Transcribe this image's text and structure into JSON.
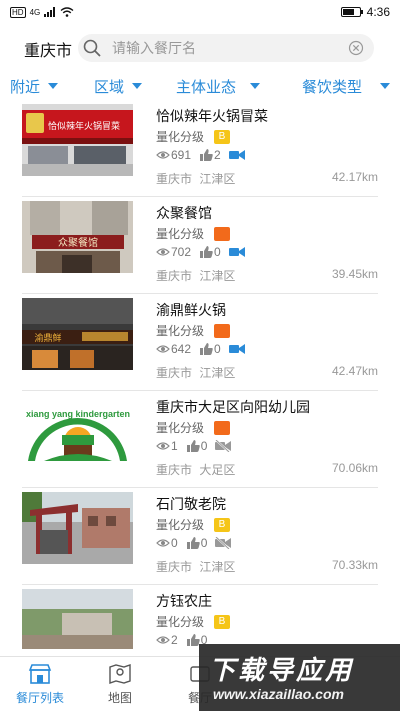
{
  "status_bar": {
    "network": "4G",
    "hd": "HD",
    "time": "4:36",
    "battery_level": 0.7
  },
  "search": {
    "city": "重庆市",
    "placeholder": "请输入餐厅名"
  },
  "filters": [
    {
      "label": "附近"
    },
    {
      "label": "区域"
    },
    {
      "label": "主体业态"
    },
    {
      "label": "餐饮类型"
    }
  ],
  "restaurants": [
    {
      "name": "恰似辣年火锅冒菜",
      "grade_label": "量化分级",
      "grade": "B",
      "grade_color": "#f5c518",
      "views": "691",
      "likes": "2",
      "video": true,
      "city": "重庆市",
      "district": "江津区",
      "distance": "42.17km",
      "sign_text": "恰似辣年火锅冒菜"
    },
    {
      "name": "众聚餐馆",
      "grade_label": "量化分级",
      "grade": "",
      "grade_color": "#f26a1b",
      "views": "702",
      "likes": "0",
      "video": true,
      "city": "重庆市",
      "district": "江津区",
      "distance": "39.45km",
      "sign_text": "众聚餐馆"
    },
    {
      "name": "渝鼎鲜火锅",
      "grade_label": "量化分级",
      "grade": "",
      "grade_color": "#f26a1b",
      "views": "642",
      "likes": "0",
      "video": true,
      "city": "重庆市",
      "district": "江津区",
      "distance": "42.47km",
      "sign_text": "渝鼎鲜"
    },
    {
      "name": "重庆市大足区向阳幼儿园",
      "grade_label": "量化分级",
      "grade": "",
      "grade_color": "#f26a1b",
      "views": "1",
      "likes": "0",
      "video": false,
      "city": "重庆市",
      "district": "大足区",
      "distance": "70.06km",
      "sign_text": "xiang yang kindergarten"
    },
    {
      "name": "石门敬老院",
      "grade_label": "量化分级",
      "grade": "B",
      "grade_color": "#f5c518",
      "views": "0",
      "likes": "0",
      "video": false,
      "city": "重庆市",
      "district": "江津区",
      "distance": "70.33km",
      "sign_text": ""
    },
    {
      "name": "方钰农庄",
      "grade_label": "量化分级",
      "grade": "B",
      "grade_color": "#f5c518",
      "views": "2",
      "likes": "0",
      "video": false,
      "city": "",
      "district": "",
      "distance": "",
      "sign_text": ""
    }
  ],
  "tabs": [
    {
      "label": "餐厅列表",
      "active": true
    },
    {
      "label": "地图",
      "active": false
    },
    {
      "label": "餐厅",
      "active": false
    }
  ],
  "watermark": {
    "title": "下载导应用",
    "url": "www.xiazaiIlao.com"
  },
  "colors": {
    "accent": "#2a8bd8",
    "grade_b": "#f5c518",
    "grade_orange": "#f26a1b"
  }
}
